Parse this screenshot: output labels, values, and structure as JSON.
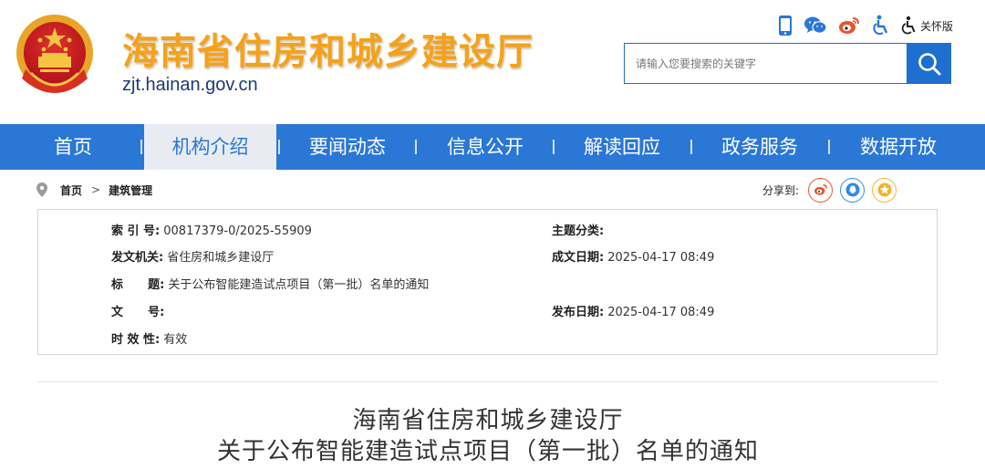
{
  "header": {
    "title": "海南省住房和城乡建设厅",
    "domain": "zjt.hainan.gov.cn",
    "care_label": "关怀版",
    "search_placeholder": "请输入您要搜索的关键字"
  },
  "nav": {
    "items": [
      "首页",
      "机构介绍",
      "要闻动态",
      "信息公开",
      "解读回应",
      "政务服务",
      "数据开放"
    ],
    "active": "机构介绍"
  },
  "breadcrumb": {
    "home": "首页",
    "arrow": ">",
    "current": "建筑管理"
  },
  "share": {
    "label": "分享到:"
  },
  "info": {
    "index_label": "索 引 号:",
    "index_value": "00817379-0/2025-55909",
    "topic_label": "主题分类:",
    "topic_value": "",
    "issuer_label": "发文机关:",
    "issuer_value": "省住房和城乡建设厅",
    "created_label": "成文日期:",
    "created_value": "2025-04-17 08:49",
    "title_label": "标      题:",
    "title_value": "关于公布智能建造试点项目（第一批）名单的通知",
    "docno_label": "文      号:",
    "docno_value": "",
    "published_label": "发布日期:",
    "published_value": "2025-04-17 08:49",
    "validity_label": "时 效 性:",
    "validity_value": "有效"
  },
  "article": {
    "title_line1": "海南省住房和城乡建设厅",
    "title_line2": "关于公布智能建造试点项目（第一批）名单的通知"
  },
  "colors": {
    "nav_blue": "#2a77d6",
    "title_orange": "#f3a21b",
    "domain_navy": "#1e3a73",
    "weibo_orange": "#e8552d",
    "qq_blue": "#2f8be6",
    "qzone_yellow": "#f1b52a"
  },
  "icons": [
    "national-emblem-icon",
    "mobile-icon",
    "wechat-icon",
    "weibo-icon",
    "accessibility-icon",
    "care-mode-icon",
    "search-icon",
    "location-pin-icon",
    "share-weibo-icon",
    "share-qq-icon",
    "share-qzone-icon"
  ]
}
